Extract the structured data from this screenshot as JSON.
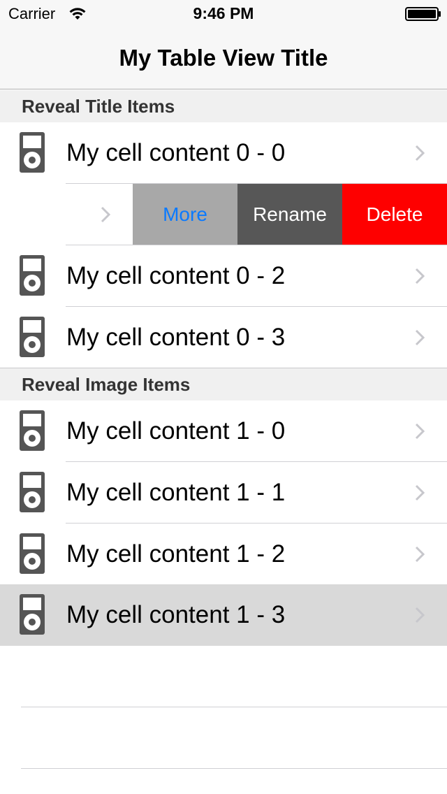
{
  "status_bar": {
    "carrier": "Carrier",
    "time": "9:46 PM",
    "wifi_icon": "wifi-icon",
    "battery_icon": "battery-icon"
  },
  "nav": {
    "title": "My Table View Title"
  },
  "sections": [
    {
      "header": "Reveal Title Items",
      "cells": [
        {
          "label": "My cell content 0 - 0",
          "icon": "ipod-icon"
        },
        {
          "label": "",
          "icon": "",
          "revealed_actions": [
            "More",
            "Rename",
            "Delete"
          ]
        },
        {
          "label": "My cell content 0 - 2",
          "icon": "ipod-icon"
        },
        {
          "label": "My cell content 0 - 3",
          "icon": "ipod-icon"
        }
      ]
    },
    {
      "header": "Reveal Image Items",
      "cells": [
        {
          "label": "My cell content 1 - 0",
          "icon": "ipod-icon"
        },
        {
          "label": "My cell content 1 - 1",
          "icon": "ipod-icon"
        },
        {
          "label": "My cell content 1 - 2",
          "icon": "ipod-icon"
        },
        {
          "label": "My cell content 1 - 3",
          "icon": "ipod-icon",
          "selected": true
        }
      ]
    }
  ],
  "colors": {
    "more": "#a8a8a8",
    "more_text": "#0a7aff",
    "rename": "#575757",
    "delete": "#fe0000",
    "selected_row": "#d9d9d9"
  }
}
